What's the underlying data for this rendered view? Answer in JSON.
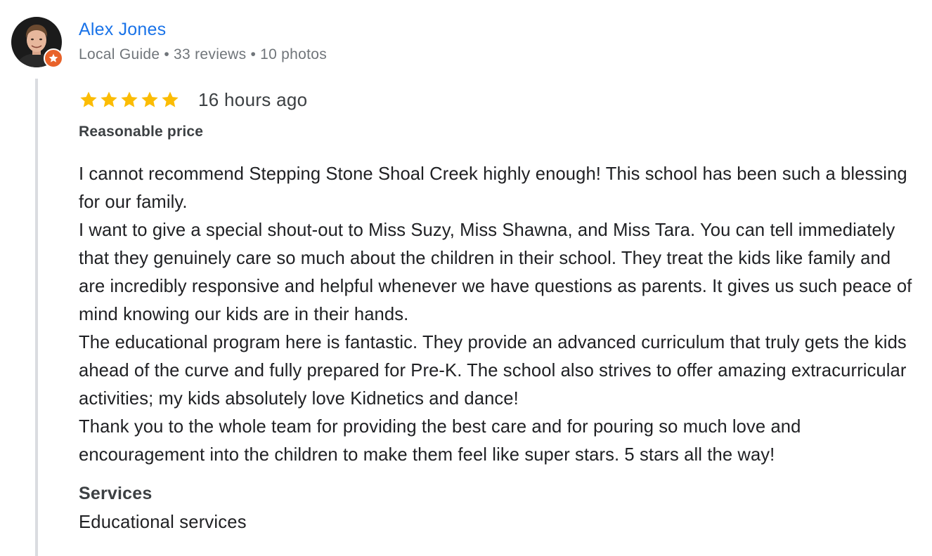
{
  "author": {
    "name": "Alex Jones",
    "badge": "Local Guide",
    "reviews": "33 reviews",
    "photos": "10 photos",
    "separator": "•"
  },
  "review": {
    "rating": 5,
    "rating_max": 5,
    "time": "16 hours ago",
    "title": "Reasonable price",
    "paragraphs": [
      "I cannot recommend Stepping Stone Shoal Creek highly enough! This school has been such a blessing for our family.",
      "I want to give a special shout-out to Miss Suzy, Miss Shawna, and Miss Tara. You can tell immediately that they genuinely care so much about the children in their school. They treat the kids like family and are incredibly responsive and helpful whenever we have questions as parents. It gives us such peace of mind knowing our kids are in their hands.",
      "The educational program here is fantastic. They provide an advanced curriculum that truly gets the kids ahead of the curve and fully prepared for Pre-K. The school also strives to offer amazing extracurricular activities; my kids absolutely love Kidnetics and dance!",
      "Thank you to the whole team for providing the best care and for pouring so much love and encouragement into the children to make them feel like super stars. 5 stars all the way!"
    ]
  },
  "services": {
    "heading": "Services",
    "value": "Educational services"
  },
  "icons": {
    "avatar": "profile-photo",
    "guide_badge": "local-guide-star-icon",
    "star": "star-icon"
  },
  "colors": {
    "name_link": "#1a73e8",
    "star": "#fbbc04",
    "guide_badge": "#e8622a",
    "meta_text": "#70757a",
    "thread_line": "#dadce0"
  }
}
